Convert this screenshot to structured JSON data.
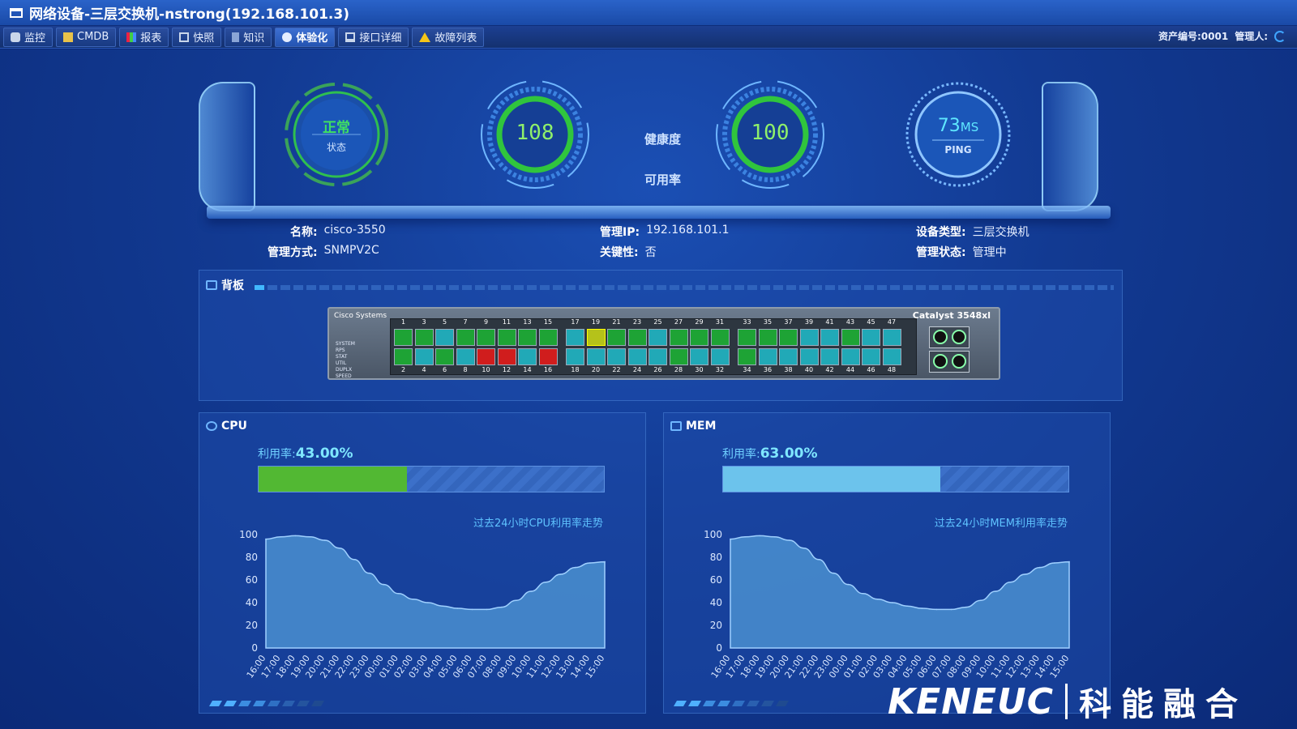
{
  "window": {
    "title": "网络设备-三层交换机-nstrong(192.168.101.3)"
  },
  "toolbar": {
    "tabs": [
      {
        "label": "监控",
        "icon": "binoculars-icon"
      },
      {
        "label": "CMDB",
        "icon": "database-icon"
      },
      {
        "label": "报表",
        "icon": "bar-chart-icon"
      },
      {
        "label": "快照",
        "icon": "snapshot-icon"
      },
      {
        "label": "知识",
        "icon": "knowledge-icon"
      },
      {
        "label": "体验化",
        "icon": "globe-icon",
        "active": true
      },
      {
        "label": "接口详细",
        "icon": "monitor-icon"
      },
      {
        "label": "故障列表",
        "icon": "warning-icon"
      }
    ],
    "asset_label": "资产编号:0001",
    "manager_label": "管理人:"
  },
  "gauges": {
    "status": {
      "value": "正常",
      "label": "状态"
    },
    "health": {
      "value": "108",
      "label": "健康度"
    },
    "availability": {
      "value": "100",
      "label": "可用率"
    },
    "ping": {
      "value": "73",
      "unit": "MS",
      "label": "PING"
    }
  },
  "device_info": {
    "name_k": "名称:",
    "name_v": "cisco-3550",
    "ip_k": "管理IP:",
    "ip_v": "192.168.101.1",
    "type_k": "设备类型:",
    "type_v": "三层交换机",
    "mgmt_k": "管理方式:",
    "mgmt_v": "SNMPV2C",
    "key_k": "关键性:",
    "key_v": "否",
    "state_k": "管理状态:",
    "state_v": "管理中"
  },
  "backplane": {
    "title": "背板",
    "brand": "Cisco Systems",
    "model": "Catalyst 3548xl",
    "led_labels": [
      "SYSTEM",
      "RPS",
      "STAT",
      "UTIL",
      "DUPLX",
      "SPEED"
    ],
    "top_numbers": [
      "1",
      "3",
      "5",
      "7",
      "9",
      "11",
      "13",
      "15",
      "17",
      "19",
      "21",
      "23",
      "25",
      "27",
      "29",
      "31",
      "33",
      "35",
      "37",
      "39",
      "41",
      "43",
      "45",
      "47"
    ],
    "bottom_numbers": [
      "2",
      "4",
      "6",
      "8",
      "10",
      "12",
      "14",
      "16",
      "18",
      "20",
      "22",
      "24",
      "26",
      "28",
      "30",
      "32",
      "34",
      "36",
      "38",
      "40",
      "42",
      "44",
      "46",
      "48"
    ],
    "top_states": [
      "green",
      "green",
      "teal",
      "green",
      "green",
      "green",
      "green",
      "green",
      "teal",
      "yellow",
      "green",
      "green",
      "teal",
      "green",
      "green",
      "green",
      "green",
      "green",
      "green",
      "teal",
      "teal",
      "green",
      "teal",
      "teal"
    ],
    "bottom_states": [
      "green",
      "teal",
      "green",
      "teal",
      "red",
      "red",
      "teal",
      "red",
      "teal",
      "teal",
      "teal",
      "teal",
      "teal",
      "green",
      "teal",
      "teal",
      "green",
      "teal",
      "teal",
      "teal",
      "teal",
      "teal",
      "teal",
      "teal"
    ]
  },
  "colors": {
    "cpu_bar": "#52b833",
    "mem_bar": "#6cc3ec",
    "area": "#4a8fd0"
  },
  "cpu": {
    "title": "CPU",
    "usage_label": "利用率:",
    "usage_value": "43.00%",
    "usage_fraction": 0.43,
    "trend_title": "过去24小时CPU利用率走势"
  },
  "mem": {
    "title": "MEM",
    "usage_label": "利用率:",
    "usage_value": "63.00%",
    "usage_fraction": 0.63,
    "trend_title": "过去24小时MEM利用率走势"
  },
  "chart_data": [
    {
      "type": "area",
      "x": [
        "16:00",
        "17:00",
        "18:00",
        "19:00",
        "20:00",
        "21:00",
        "22:00",
        "23:00",
        "00:00",
        "01:00",
        "02:00",
        "03:00",
        "04:00",
        "05:00",
        "06:00",
        "07:00",
        "08:00",
        "09:00",
        "10:00",
        "11:00",
        "12:00",
        "13:00",
        "14:00",
        "15:00"
      ],
      "values": [
        96,
        98,
        99,
        98,
        95,
        88,
        78,
        66,
        56,
        48,
        43,
        40,
        37,
        35,
        34,
        34,
        36,
        42,
        50,
        58,
        65,
        71,
        75,
        76
      ],
      "ylim": [
        0,
        100
      ],
      "yticks": [
        "0",
        "20",
        "40",
        "60",
        "80",
        "100"
      ]
    },
    {
      "type": "area",
      "x": [
        "16:00",
        "17:00",
        "18:00",
        "19:00",
        "20:00",
        "21:00",
        "22:00",
        "23:00",
        "00:00",
        "01:00",
        "02:00",
        "03:00",
        "04:00",
        "05:00",
        "06:00",
        "07:00",
        "08:00",
        "09:00",
        "10:00",
        "11:00",
        "12:00",
        "13:00",
        "14:00",
        "15:00"
      ],
      "values": [
        96,
        98,
        99,
        98,
        95,
        88,
        78,
        66,
        56,
        48,
        43,
        40,
        37,
        35,
        34,
        34,
        36,
        42,
        50,
        58,
        65,
        71,
        75,
        76
      ],
      "ylim": [
        0,
        100
      ],
      "yticks": [
        "0",
        "20",
        "40",
        "60",
        "80",
        "100"
      ]
    }
  ],
  "logo": {
    "en": "KENEUC",
    "cn": "科能融合"
  }
}
